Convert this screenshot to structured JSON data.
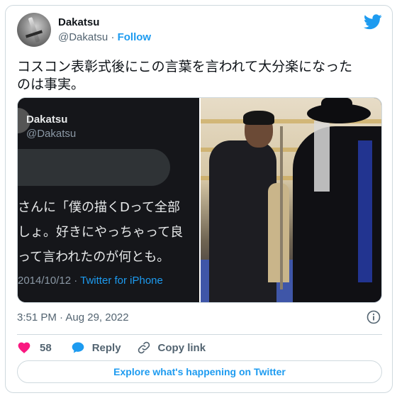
{
  "author": {
    "name": "Dakatsu",
    "handle": "@Dakatsu",
    "separator": "·",
    "follow_label": "Follow"
  },
  "tweet": {
    "line1": "コスコン表彰式後にこの言葉を言われて大分楽になった",
    "line2": "のは事実。",
    "timestamp": "3:51 PM · Aug 29, 2022"
  },
  "embedded_screenshot": {
    "name": "Dakatsu",
    "handle": "@Dakatsu",
    "line1": "さんに「僕の描くDって全部",
    "line2": "しょ。好きにやっちゃって良",
    "line3": "って言われたのが何とも。",
    "date": "2014/10/12 · ",
    "source": "Twitter for iPhone"
  },
  "actions": {
    "like_count": "58",
    "reply_label": "Reply",
    "copy_label": "Copy link"
  },
  "explore_label": "Explore what's happening on Twitter",
  "colors": {
    "accent": "#1d9bf0",
    "like": "#f91880",
    "muted": "#536471"
  },
  "icons": [
    "twitter-bird-icon",
    "info-icon",
    "heart-icon",
    "reply-bubble-icon",
    "link-icon"
  ]
}
